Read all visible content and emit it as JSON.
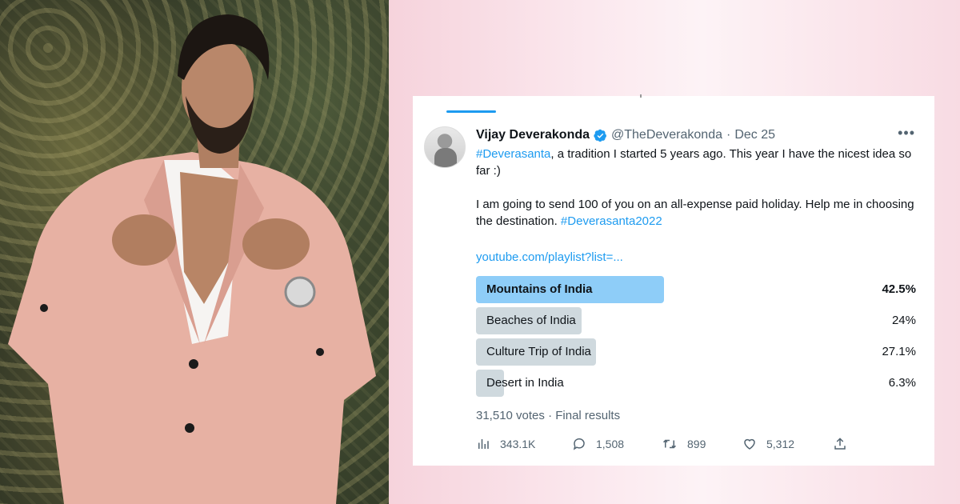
{
  "tweet": {
    "author_name": "Vijay Deverakonda",
    "handle": "@TheDeverakonda",
    "separator": "·",
    "date": "Dec 25",
    "more": "•••",
    "line1_hashtag": "#Deverasanta",
    "line1_rest": ", a tradition I started 5 years ago. This year I have the nicest idea so far :)",
    "line2": "I am going to send 100 of you on an all-expense paid holiday. Help me in choosing the destination.",
    "line2_hashtag": "#Deverasanta2022",
    "link": "youtube.com/playlist?list=..."
  },
  "poll": {
    "options": [
      {
        "label": "Mountains of India",
        "percent_text": "42.5%",
        "fraction": 0.425,
        "winner": true
      },
      {
        "label": "Beaches of India",
        "percent_text": "24%",
        "fraction": 0.24,
        "winner": false
      },
      {
        "label": "Culture Trip of India",
        "percent_text": "27.1%",
        "fraction": 0.271,
        "winner": false
      },
      {
        "label": "Desert in India",
        "percent_text": "6.3%",
        "fraction": 0.063,
        "winner": false
      }
    ],
    "summary": "31,510 votes · Final results"
  },
  "actions": {
    "views": "343.1K",
    "replies": "1,508",
    "retweets": "899",
    "likes": "5,312"
  },
  "colors": {
    "accent": "#1d9bf0",
    "winner_bar": "#8ecdf8",
    "bar": "#cfd9de",
    "secondary_text": "#536471"
  },
  "icons": [
    "verified-badge-icon",
    "more-icon",
    "views-icon",
    "reply-icon",
    "retweet-icon",
    "like-icon",
    "share-icon"
  ]
}
